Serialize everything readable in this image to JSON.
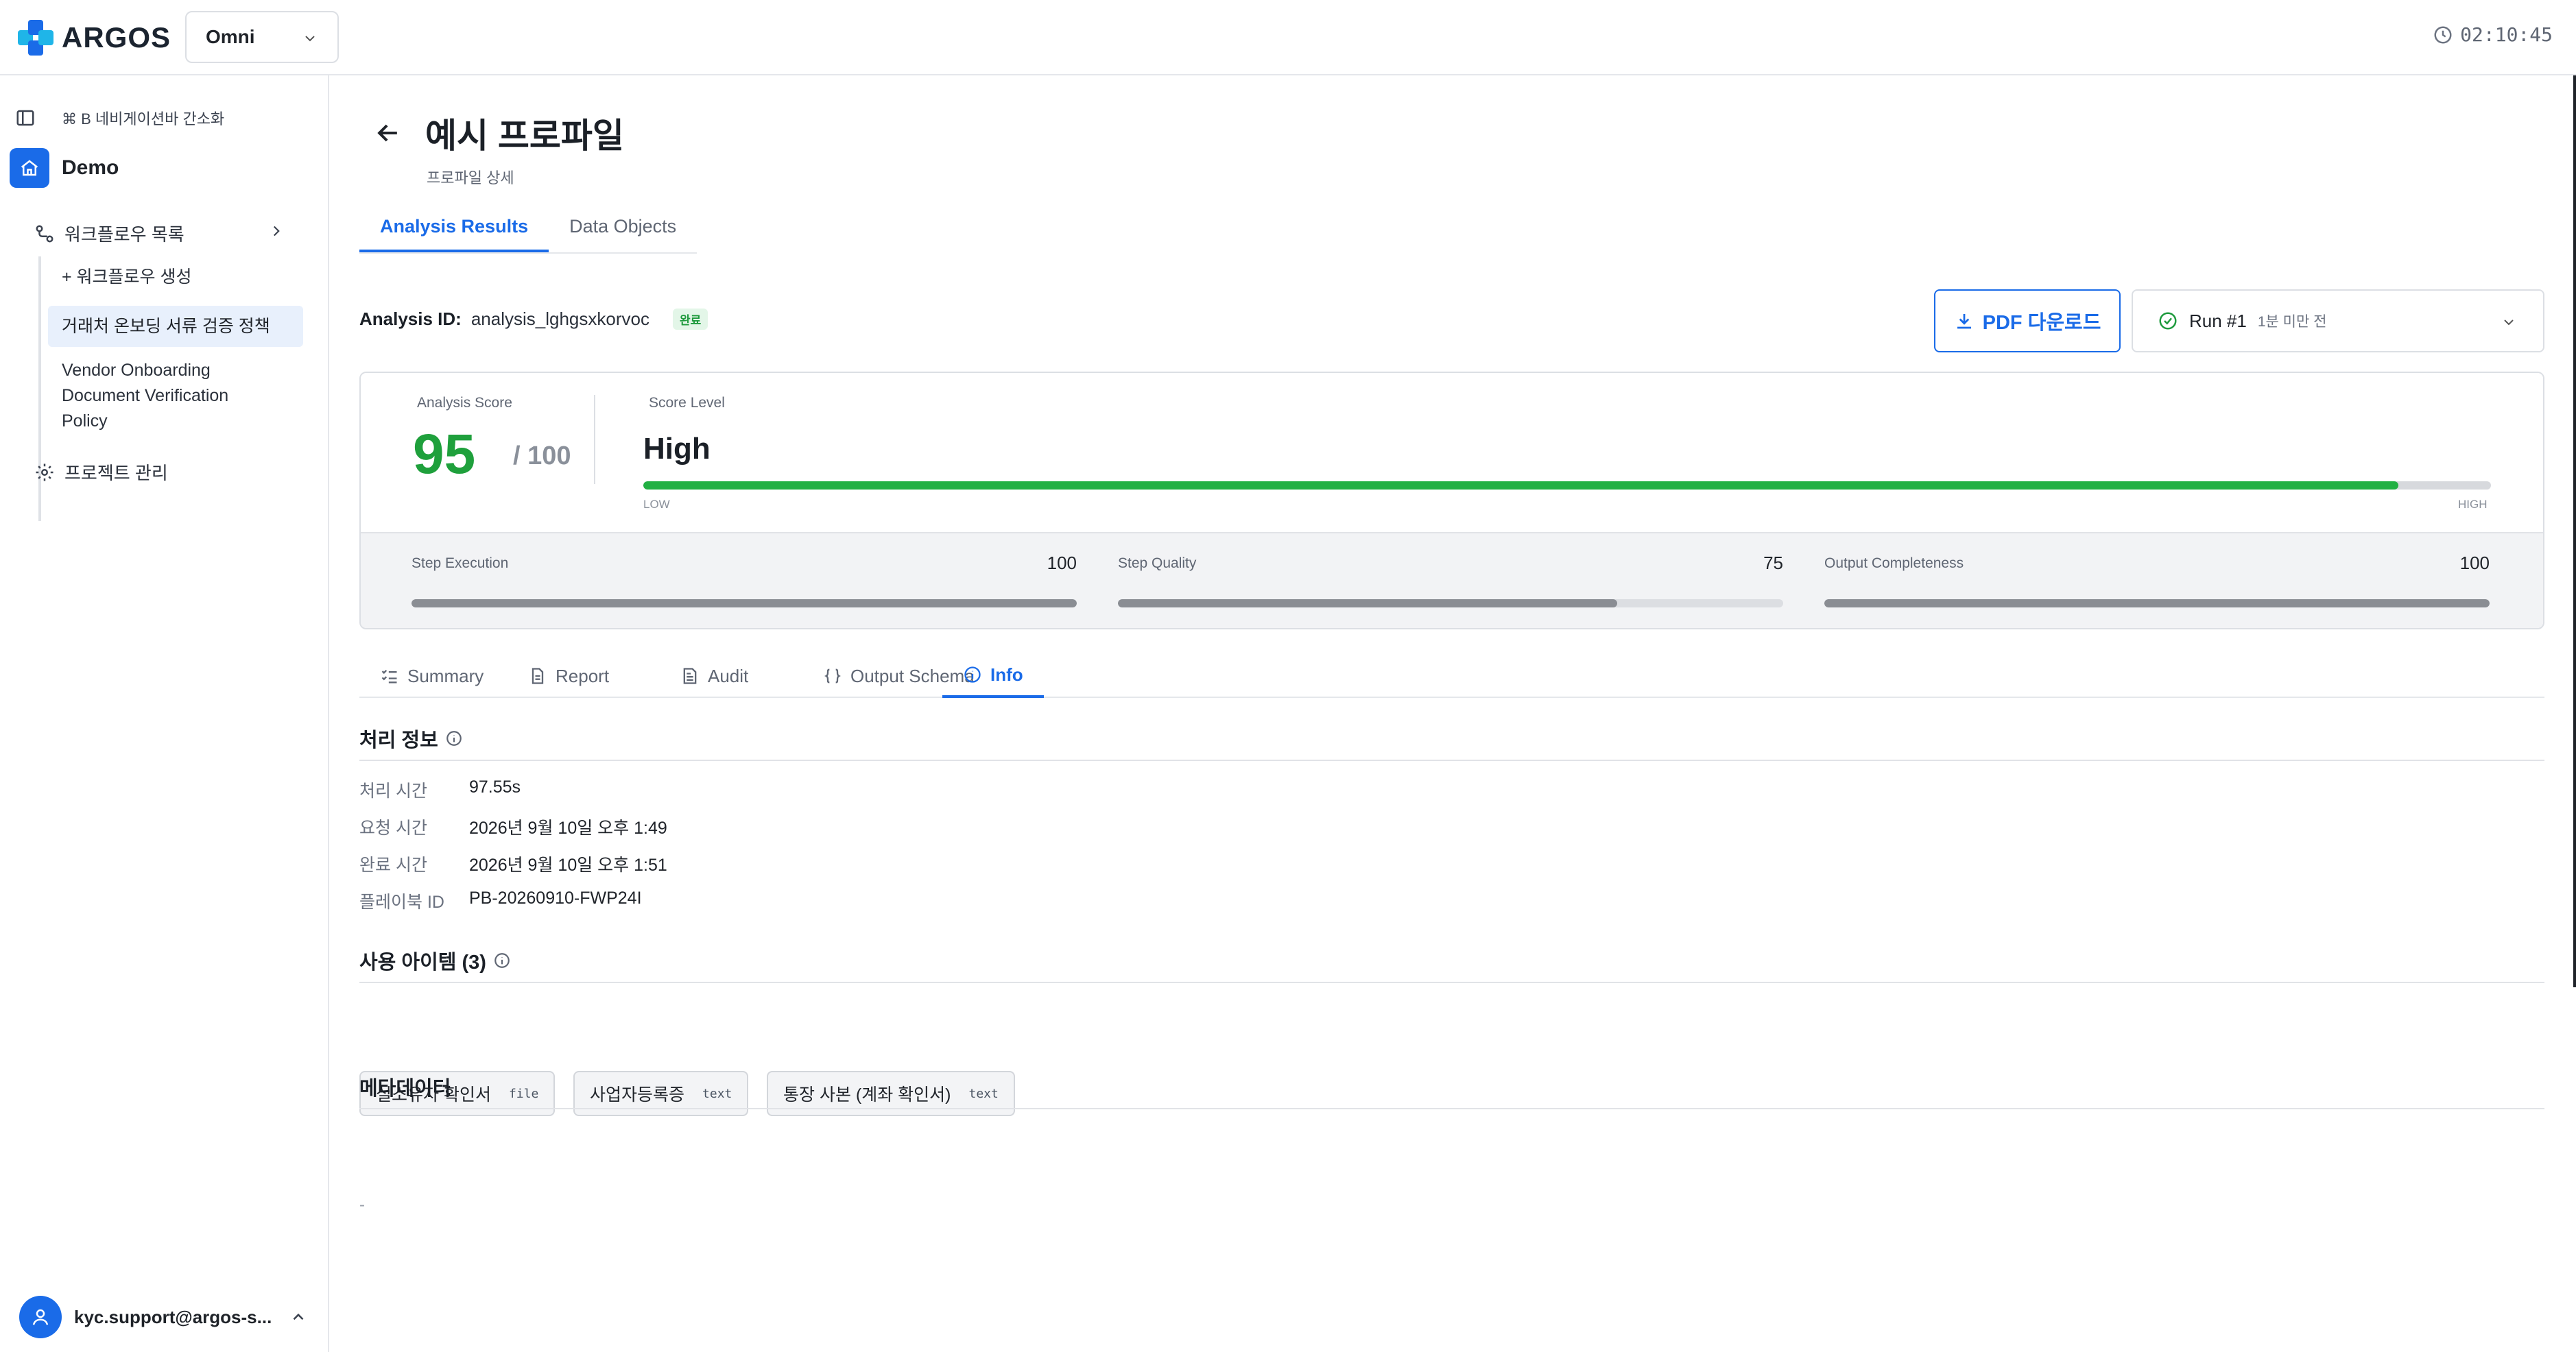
{
  "app": {
    "logo_text": "ARGOS",
    "workspace": "Omni",
    "clock": "02:10:45",
    "brand_color": "#1a6be8"
  },
  "sidebar": {
    "toggle_label": "⌘ B 네비게이션바 간소화",
    "project": "Demo",
    "workflows_label": "워크플로우 목록",
    "create_workflow": "+ 워크플로우 생성",
    "items": [
      {
        "label": "거래처 온보딩 서류 검증 정책",
        "active": true
      },
      {
        "label": "Vendor Onboarding Document Verification Policy",
        "active": false
      }
    ],
    "settings_label": "프로젝트 관리",
    "user_email": "kyc.support@argos-s..."
  },
  "page": {
    "title": "예시 프로파일",
    "subtitle": "프로파일 상세",
    "tabs": [
      {
        "label": "Analysis Results",
        "active": true
      },
      {
        "label": "Data Objects",
        "active": false
      }
    ],
    "analysis_id_label": "Analysis ID:",
    "analysis_id": "analysis_lghgsxkorvoc",
    "status_badge": "완료",
    "pdf_button": "PDF 다운로드",
    "run_label": "Run #1",
    "run_ago": "1분 미만 전"
  },
  "score": {
    "analysis_score_label": "Analysis Score",
    "value": "95",
    "max": "/ 100",
    "level_label": "Score Level",
    "level": "High",
    "level_fraction": 0.95,
    "low_label": "LOW",
    "high_label": "HIGH",
    "metrics": [
      {
        "name": "Step Execution",
        "value": "100",
        "fraction": 1.0
      },
      {
        "name": "Step Quality",
        "value": "75",
        "fraction": 0.75
      },
      {
        "name": "Output Completeness",
        "value": "100",
        "fraction": 1.0
      }
    ]
  },
  "sub_tabs": [
    {
      "label": "Summary",
      "icon": "list-check-icon",
      "active": false
    },
    {
      "label": "Report",
      "icon": "document-icon",
      "active": false
    },
    {
      "label": "Audit",
      "icon": "audit-icon",
      "active": false
    },
    {
      "label": "Output Schema",
      "icon": "braces-icon",
      "active": false
    },
    {
      "label": "Info",
      "icon": "info-icon",
      "active": true
    }
  ],
  "processing": {
    "title": "처리 정보",
    "rows": [
      {
        "key": "처리 시간",
        "value": "97.55s"
      },
      {
        "key": "요청 시간",
        "value": "2026년 9월 10일 오후 1:49"
      },
      {
        "key": "완료 시간",
        "value": "2026년 9월 10일 오후 1:51"
      },
      {
        "key": "플레이북 ID",
        "value": "PB-20260910-FWP24I"
      }
    ]
  },
  "items_used": {
    "title": "사용 아이템 (3)",
    "chips": [
      {
        "name": "실소유자 확인서",
        "type": "file"
      },
      {
        "name": "사업자등록증",
        "type": "text"
      },
      {
        "name": "통장 사본 (계좌 확인서)",
        "type": "text"
      }
    ]
  },
  "metadata": {
    "title": "메타데이터",
    "value": "-"
  }
}
